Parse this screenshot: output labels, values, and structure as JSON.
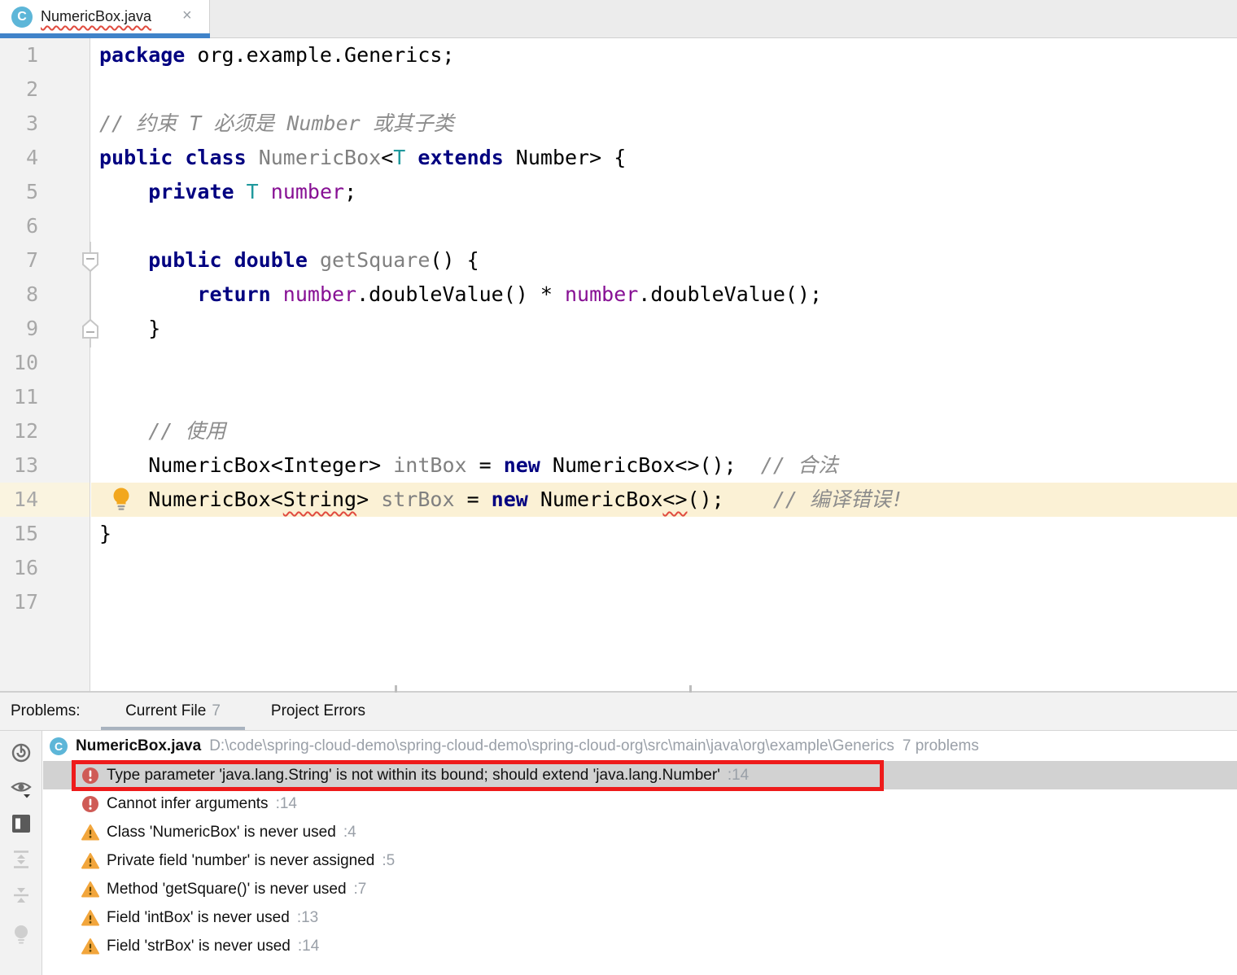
{
  "tab": {
    "title": "NumericBox.java",
    "close_glyph": "×",
    "icon_letter": "C"
  },
  "editor": {
    "line_count": 17,
    "highlight_line": 14,
    "lines": {
      "1": [
        {
          "t": "package",
          "c": "k"
        },
        {
          "t": " org.example.Generics;",
          "c": "p"
        }
      ],
      "3": [
        {
          "t": "// 约束 T 必须是 Number 或其子类",
          "c": "c"
        }
      ],
      "4": [
        {
          "t": "public class",
          "c": "k"
        },
        {
          "t": " ",
          "c": "p"
        },
        {
          "t": "NumericBox",
          "c": "u"
        },
        {
          "t": "<",
          "c": "p"
        },
        {
          "t": "T",
          "c": "t"
        },
        {
          "t": " ",
          "c": "p"
        },
        {
          "t": "extends",
          "c": "k"
        },
        {
          "t": " Number> {",
          "c": "p"
        }
      ],
      "5": [
        {
          "t": "    ",
          "c": "p"
        },
        {
          "t": "private",
          "c": "k"
        },
        {
          "t": " ",
          "c": "p"
        },
        {
          "t": "T",
          "c": "t"
        },
        {
          "t": " ",
          "c": "p"
        },
        {
          "t": "number",
          "c": "f"
        },
        {
          "t": ";",
          "c": "p"
        }
      ],
      "7": [
        {
          "t": "    ",
          "c": "p"
        },
        {
          "t": "public double",
          "c": "k"
        },
        {
          "t": " ",
          "c": "p"
        },
        {
          "t": "getSquare",
          "c": "u"
        },
        {
          "t": "() {",
          "c": "p"
        }
      ],
      "8": [
        {
          "t": "        ",
          "c": "p"
        },
        {
          "t": "return",
          "c": "k"
        },
        {
          "t": " ",
          "c": "p"
        },
        {
          "t": "number",
          "c": "f"
        },
        {
          "t": ".doubleValue() * ",
          "c": "p"
        },
        {
          "t": "number",
          "c": "f"
        },
        {
          "t": ".doubleValue();",
          "c": "p"
        }
      ],
      "9": [
        {
          "t": "    }",
          "c": "p"
        }
      ],
      "12": [
        {
          "t": "    ",
          "c": "p"
        },
        {
          "t": "// 使用",
          "c": "c"
        }
      ],
      "13": [
        {
          "t": "    NumericBox<Integer> ",
          "c": "p"
        },
        {
          "t": "intBox",
          "c": "u"
        },
        {
          "t": " = ",
          "c": "p"
        },
        {
          "t": "new",
          "c": "k"
        },
        {
          "t": " NumericBox<>();  ",
          "c": "p"
        },
        {
          "t": "// 合法",
          "c": "c"
        }
      ],
      "14": [
        {
          "t": "    NumericBox<",
          "c": "p"
        },
        {
          "t": "String",
          "c": "pw"
        },
        {
          "t": "> ",
          "c": "p"
        },
        {
          "t": "strBox",
          "c": "u"
        },
        {
          "t": " = ",
          "c": "p"
        },
        {
          "t": "new",
          "c": "k"
        },
        {
          "t": " NumericBox",
          "c": "p"
        },
        {
          "t": "<>",
          "c": "pw"
        },
        {
          "t": "();    ",
          "c": "p"
        },
        {
          "t": "// 编译错误!",
          "c": "c"
        }
      ],
      "15": [
        {
          "t": "}",
          "c": "p"
        }
      ]
    }
  },
  "problems": {
    "label": "Problems:",
    "tab_current": {
      "label": "Current File",
      "count": "7"
    },
    "tab_project": {
      "label": "Project Errors"
    },
    "file": {
      "icon_letter": "C",
      "name": "NumericBox.java",
      "path": "D:\\code\\spring-cloud-demo\\spring-cloud-demo\\spring-cloud-org\\src\\main\\java\\org\\example\\Generics",
      "meta": "7 problems"
    },
    "rows": [
      {
        "sev": "error",
        "text": "Type parameter 'java.lang.String' is not within its bound; should extend 'java.lang.Number'",
        "line": ":14",
        "selected": true,
        "annotated": true
      },
      {
        "sev": "error",
        "text": "Cannot infer arguments",
        "line": ":14"
      },
      {
        "sev": "warning",
        "text": "Class 'NumericBox' is never used",
        "line": ":4"
      },
      {
        "sev": "warning",
        "text": "Private field 'number' is never assigned",
        "line": ":5"
      },
      {
        "sev": "warning",
        "text": "Method 'getSquare()' is never used",
        "line": ":7"
      },
      {
        "sev": "warning",
        "text": "Field 'intBox' is never used",
        "line": ":13"
      },
      {
        "sev": "warning",
        "text": "Field 'strBox' is never used",
        "line": ":14"
      }
    ],
    "toolbar_icons": [
      "power-circle-icon",
      "preview-eye-icon",
      "layout-panel-icon",
      "expand-all-icon",
      "collapse-all-icon",
      "quickfix-bulb-icon"
    ]
  },
  "gutter": {
    "quickfix_bulb_line": 14,
    "fold_region_lines": "7-9"
  },
  "colors": {
    "accent_blue": "#4083c9",
    "error_red": "#cf5b56",
    "warning_amber": "#f2a63c",
    "warning_mark": "#5c4400",
    "annotation_red": "#ee1b1b",
    "line_highlight": "#fbf1d5",
    "keyword_navy": "#000080",
    "field_purple": "#871094",
    "type_param_teal": "#20999d",
    "comment_gray": "#8c8c8c",
    "unused_gray": "#808080",
    "class_icon_blue": "#5db6d8",
    "selected_row_gray": "#d2d2d2"
  }
}
